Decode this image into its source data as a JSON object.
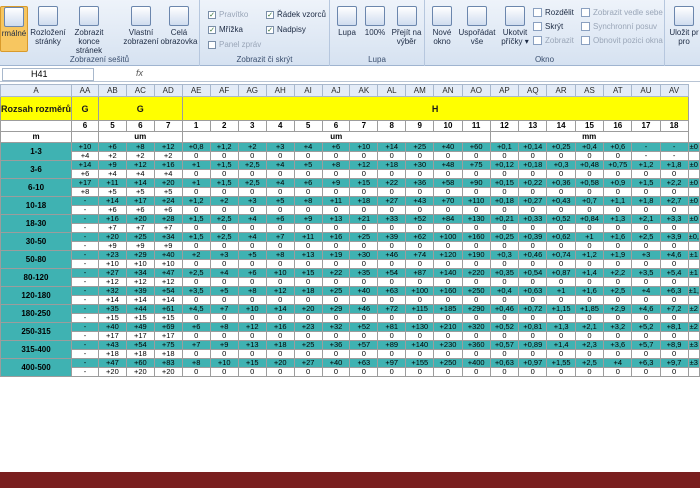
{
  "ribbon": {
    "group1_title": "Zobrazení sešitů",
    "group1_buttons": [
      "rmálné",
      "Rozložení stránky",
      "Zobrazit konce stránek",
      "Vlastní zobrazení",
      "Celá obrazovka"
    ],
    "group2_title": "Zobrazit či skrýt",
    "group2_checks": [
      {
        "label": "Pravítko",
        "checked": true,
        "disabled": true
      },
      {
        "label": "Mřížka",
        "checked": true,
        "disabled": false
      },
      {
        "label": "Panel zpráv",
        "checked": false,
        "disabled": true
      },
      {
        "label": "Řádek vzorců",
        "checked": true,
        "disabled": false
      },
      {
        "label": "Nadpisy",
        "checked": true,
        "disabled": false
      }
    ],
    "group3_title": "Lupa",
    "group3_buttons": [
      "Lupa",
      "100%",
      "Přejít na výběr"
    ],
    "group4_title": "Okno",
    "group4_buttons": [
      "Nové okno",
      "Uspořádat vše",
      "Ukotvit příčky ▾"
    ],
    "group4_items": [
      {
        "label": "Rozdělit",
        "disabled": false
      },
      {
        "label": "Skrýt",
        "disabled": false
      },
      {
        "label": "Zobrazit",
        "disabled": true
      },
      {
        "label": "Zobrazit vedle sebe",
        "disabled": true
      },
      {
        "label": "Synchronní posuv",
        "disabled": true
      },
      {
        "label": "Obnovit pozici okna",
        "disabled": true
      }
    ],
    "group5_button": "Uložit pr pro"
  },
  "formula_bar": {
    "name_box": "H41",
    "fx": "fx"
  },
  "columns": [
    "A",
    "AA",
    "AB",
    "AC",
    "AD",
    "AE",
    "AF",
    "AG",
    "AH",
    "AI",
    "AJ",
    "AK",
    "AL",
    "AM",
    "AN",
    "AO",
    "AP",
    "AQ",
    "AR",
    "AS",
    "AT",
    "AU",
    "AV"
  ],
  "header": {
    "a_label": "Rozsah rozměrů",
    "g_partial": "G",
    "g_label": "G",
    "h_label": "H",
    "numbers": [
      "6",
      "5",
      "6",
      "7",
      "1",
      "2",
      "3",
      "4",
      "5",
      "6",
      "7",
      "8",
      "9",
      "10",
      "11",
      "12",
      "13",
      "14",
      "15",
      "16",
      "17",
      "18"
    ],
    "units": {
      "a": "m",
      "g": "um",
      "h_um": "um",
      "h_mm": "mm"
    }
  },
  "rows": [
    {
      "size": "1-3",
      "top": [
        "+10",
        "+6",
        "+8",
        "+12",
        "+0,8",
        "+1,2",
        "+2",
        "+3",
        "+4",
        "+6",
        "+10",
        "+14",
        "+25",
        "+40",
        "+60",
        "+0,1",
        "+0,14",
        "+0,25",
        "+0,4",
        "+0,6",
        "-",
        "-",
        "±0"
      ],
      "bot": [
        "+4",
        "+2",
        "+2",
        "+2",
        "0",
        "0",
        "0",
        "0",
        "0",
        "0",
        "0",
        "0",
        "0",
        "0",
        "0",
        "0",
        "0",
        "0",
        "0",
        "0",
        "-",
        "-",
        ""
      ]
    },
    {
      "size": "3-6",
      "top": [
        "+14",
        "+9",
        "+12",
        "+16",
        "+1",
        "+1,5",
        "+2,5",
        "+4",
        "+5",
        "+8",
        "+12",
        "+18",
        "+30",
        "+48",
        "+75",
        "+0,12",
        "+0,18",
        "+0,3",
        "+0,48",
        "+0,75",
        "+1,2",
        "+1,8",
        "±0"
      ],
      "bot": [
        "+6",
        "+4",
        "+4",
        "+4",
        "0",
        "0",
        "0",
        "0",
        "0",
        "0",
        "0",
        "0",
        "0",
        "0",
        "0",
        "0",
        "0",
        "0",
        "0",
        "0",
        "0",
        "0",
        ""
      ]
    },
    {
      "size": "6-10",
      "top": [
        "+17",
        "+11",
        "+14",
        "+20",
        "+1",
        "+1,5",
        "+2,5",
        "+4",
        "+6",
        "+9",
        "+15",
        "+22",
        "+36",
        "+58",
        "+90",
        "+0,15",
        "+0,22",
        "+0,36",
        "+0,58",
        "+0,9",
        "+1,5",
        "+2,2",
        "±0"
      ],
      "bot": [
        "+8",
        "+5",
        "+5",
        "+5",
        "0",
        "0",
        "0",
        "0",
        "0",
        "0",
        "0",
        "0",
        "0",
        "0",
        "0",
        "0",
        "0",
        "0",
        "0",
        "0",
        "0",
        "0",
        ""
      ]
    },
    {
      "size": "10-18",
      "top": [
        "-",
        "+14",
        "+17",
        "+24",
        "+1,2",
        "+2",
        "+3",
        "+5",
        "+8",
        "+11",
        "+18",
        "+27",
        "+43",
        "+70",
        "+110",
        "+0,18",
        "+0,27",
        "+0,43",
        "+0,7",
        "+1,1",
        "+1,8",
        "+2,7",
        "±0"
      ],
      "bot": [
        "-",
        "+6",
        "+6",
        "+6",
        "0",
        "0",
        "0",
        "0",
        "0",
        "0",
        "0",
        "0",
        "0",
        "0",
        "0",
        "0",
        "0",
        "0",
        "0",
        "0",
        "0",
        "0",
        ""
      ]
    },
    {
      "size": "18-30",
      "top": [
        "-",
        "+16",
        "+20",
        "+28",
        "+1,5",
        "+2,5",
        "+4",
        "+6",
        "+9",
        "+13",
        "+21",
        "+33",
        "+52",
        "+84",
        "+130",
        "+0,21",
        "+0,33",
        "+0,52",
        "+0,84",
        "+1,3",
        "+2,1",
        "+3,3",
        "±0"
      ],
      "bot": [
        "-",
        "+7",
        "+7",
        "+7",
        "0",
        "0",
        "0",
        "0",
        "0",
        "0",
        "0",
        "0",
        "0",
        "0",
        "0",
        "0",
        "0",
        "0",
        "0",
        "0",
        "0",
        "0",
        ""
      ]
    },
    {
      "size": "30-50",
      "top": [
        "-",
        "+20",
        "+25",
        "+34",
        "+1,5",
        "+2,5",
        "+4",
        "+7",
        "+11",
        "+16",
        "+25",
        "+39",
        "+62",
        "+100",
        "+160",
        "+0,25",
        "+0,39",
        "+0,62",
        "+1",
        "+1,6",
        "+2,5",
        "+3,9",
        "±0,"
      ],
      " bot": [],
      "bot": [
        "-",
        "+9",
        "+9",
        "+9",
        "0",
        "0",
        "0",
        "0",
        "0",
        "0",
        "0",
        "0",
        "0",
        "0",
        "0",
        "0",
        "0",
        "0",
        "0",
        "0",
        "0",
        "0",
        ""
      ]
    },
    {
      "size": "50-80",
      "top": [
        "-",
        "+23",
        "+29",
        "+40",
        "+2",
        "+3",
        "+5",
        "+8",
        "+13",
        "+19",
        "+30",
        "+46",
        "+74",
        "+120",
        "+190",
        "+0,3",
        "+0,46",
        "+0,74",
        "+1,2",
        "+1,9",
        "+3",
        "+4,6",
        "±1"
      ],
      "bot": [
        "-",
        "+10",
        "+10",
        "+10",
        "0",
        "0",
        "0",
        "0",
        "0",
        "0",
        "0",
        "0",
        "0",
        "0",
        "0",
        "0",
        "0",
        "0",
        "0",
        "0",
        "0",
        "0",
        ""
      ]
    },
    {
      "size": "80-120",
      "top": [
        "-",
        "+27",
        "+34",
        "+47",
        "+2,5",
        "+4",
        "+6",
        "+10",
        "+15",
        "+22",
        "+35",
        "+54",
        "+87",
        "+140",
        "+220",
        "+0,35",
        "+0,54",
        "+0,87",
        "+1,4",
        "+2,2",
        "+3,5",
        "+5,4",
        "±1"
      ],
      "bot": [
        "-",
        "+12",
        "+12",
        "+12",
        "0",
        "0",
        "0",
        "0",
        "0",
        "0",
        "0",
        "0",
        "0",
        "0",
        "0",
        "0",
        "0",
        "0",
        "0",
        "0",
        "0",
        "0",
        ""
      ]
    },
    {
      "size": "120-180",
      "top": [
        "-",
        "+32",
        "+39",
        "+54",
        "+3,5",
        "+5",
        "+8",
        "+12",
        "+18",
        "+25",
        "+40",
        "+63",
        "+100",
        "+160",
        "+250",
        "+0,4",
        "+0,63",
        "+1",
        "+1,6",
        "+2,5",
        "+4",
        "+6,3",
        "±1,"
      ],
      "bot": [
        "-",
        "+14",
        "+14",
        "+14",
        "0",
        "0",
        "0",
        "0",
        "0",
        "0",
        "0",
        "0",
        "0",
        "0",
        "0",
        "0",
        "0",
        "0",
        "0",
        "0",
        "0",
        "0",
        ""
      ]
    },
    {
      "size": "180-250",
      "top": [
        "-",
        "+35",
        "+44",
        "+61",
        "+4,5",
        "+7",
        "+10",
        "+14",
        "+20",
        "+29",
        "+46",
        "+72",
        "+115",
        "+185",
        "+290",
        "+0,46",
        "+0,72",
        "+1,15",
        "+1,85",
        "+2,9",
        "+4,6",
        "+7,2",
        "±2"
      ],
      "bot": [
        "-",
        "+15",
        "+15",
        "+15",
        "0",
        "0",
        "0",
        "0",
        "0",
        "0",
        "0",
        "0",
        "0",
        "0",
        "0",
        "0",
        "0",
        "0",
        "0",
        "0",
        "0",
        "0",
        ""
      ]
    },
    {
      "size": "250-315",
      "top": [
        "-",
        "+40",
        "+49",
        "+69",
        "+6",
        "+8",
        "+12",
        "+16",
        "+23",
        "+32",
        "+52",
        "+81",
        "+130",
        "+210",
        "+320",
        "+0,52",
        "+0,81",
        "+1,3",
        "+2,1",
        "+3,2",
        "+5,2",
        "+8,1",
        "±2"
      ],
      "bot": [
        "-",
        "+17",
        "+17",
        "+17",
        "0",
        "0",
        "0",
        "0",
        "0",
        "0",
        "0",
        "0",
        "0",
        "0",
        "0",
        "0",
        "0",
        "0",
        "0",
        "0",
        "0",
        "0",
        ""
      ]
    },
    {
      "size": "315-400",
      "top": [
        "-",
        "+43",
        "+54",
        "+75",
        "+7",
        "+9",
        "+13",
        "+18",
        "+25",
        "+36",
        "+57",
        "+89",
        "+140",
        "+230",
        "+360",
        "+0,57",
        "+0,89",
        "+1,4",
        "+2,3",
        "+3,6",
        "+5,7",
        "+8,9",
        "±3"
      ],
      "bot": [
        "-",
        "+18",
        "+18",
        "+18",
        "0",
        "0",
        "0",
        "0",
        "0",
        "0",
        "0",
        "0",
        "0",
        "0",
        "0",
        "0",
        "0",
        "0",
        "0",
        "0",
        "0",
        "0",
        ""
      ]
    },
    {
      "size": "400-500",
      "top": [
        "-",
        "+47",
        "+60",
        "+83",
        "+8",
        "+10",
        "+15",
        "+20",
        "+27",
        "+40",
        "+63",
        "+97",
        "+155",
        "+250",
        "+400",
        "+0,63",
        "+0,97",
        "+1,55",
        "+2,5",
        "+4",
        "+6,3",
        "+9,7",
        "±3"
      ],
      "bot": [
        "-",
        "+20",
        "+20",
        "+20",
        "0",
        "0",
        "0",
        "0",
        "0",
        "0",
        "0",
        "0",
        "0",
        "0",
        "0",
        "0",
        "0",
        "0",
        "0",
        "0",
        "0",
        "0",
        ""
      ]
    }
  ],
  "colors": {
    "teal": "#3fb2b2",
    "yellow": "#ffff00",
    "ribbon": "#dfe8f4",
    "border": "#7a1f1f"
  }
}
